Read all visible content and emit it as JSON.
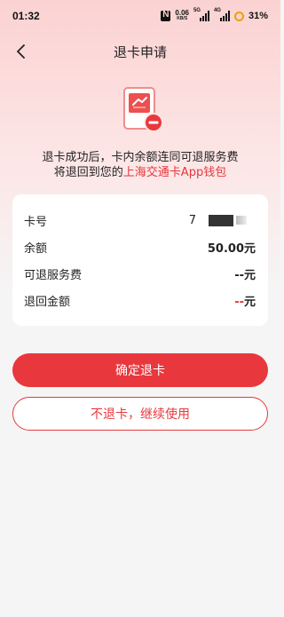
{
  "status_bar": {
    "time": "01:32",
    "net_speed": "0.06",
    "net_unit": "KB/S",
    "signal_1_label": "5G",
    "signal_2_label": "4G",
    "battery": "31%"
  },
  "header": {
    "title": "退卡申请"
  },
  "hero": {
    "icon": "card-remove-icon"
  },
  "description": {
    "line1": "退卡成功后，卡内余额连同可退服务费",
    "line2_prefix": "将退回到您的",
    "line2_highlight": "上海交通卡App钱包"
  },
  "details": {
    "card_no_label": "卡号",
    "card_no_value": "7",
    "balance_label": "余额",
    "balance_value": "50.00元",
    "service_fee_label": "可退服务费",
    "service_fee_value": "--元",
    "refund_label": "退回金额",
    "refund_dash": "--",
    "refund_unit": "元"
  },
  "actions": {
    "confirm_label": "确定退卡",
    "cancel_label": "不退卡，继续使用"
  },
  "colors": {
    "accent": "#e8383d",
    "header_gradient_top": "#fbd2d2",
    "background": "#f5f5f5"
  }
}
